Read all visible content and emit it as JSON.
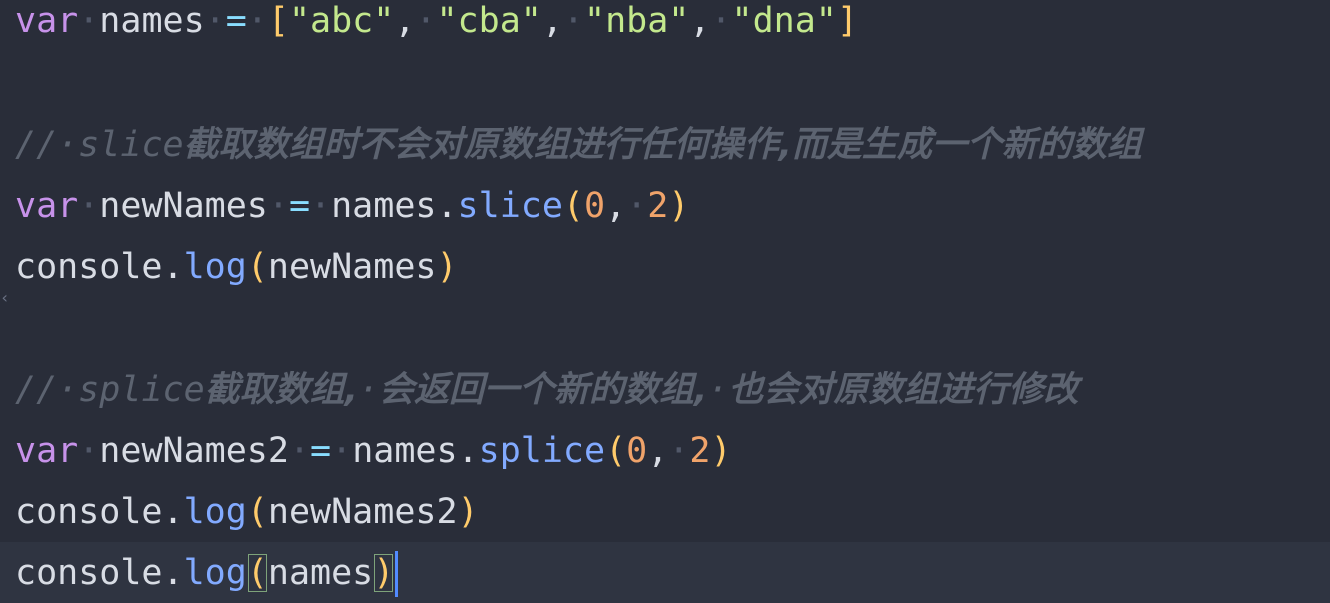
{
  "editor": {
    "background": "#292d39",
    "colors": {
      "keyword": "#c792ea",
      "identifier": "#d8dce4",
      "operator": "#89ddff",
      "string": "#c3e88d",
      "number": "#f0a36a",
      "function": "#82aaff",
      "bracket": "#ffcb6b",
      "comment": "#5c6370",
      "cursor": "#528bff"
    },
    "line1": {
      "kw": "var",
      "name": "names",
      "eq": "=",
      "open": "[",
      "s1": "\"abc\"",
      "s2": "\"cba\"",
      "s3": "\"nba\"",
      "s4": "\"dna\"",
      "close": "]"
    },
    "line3": {
      "slashes": "//",
      "word": "slice",
      "text": "截取数组时不会对原数组进行任何操作,而是生成一个新的数组"
    },
    "line4": {
      "kw": "var",
      "name": "newNames",
      "eq": "=",
      "obj": "names",
      "dot": ".",
      "method": "slice",
      "open": "(",
      "a": "0",
      "comma": ",",
      "b": "2",
      "close": ")"
    },
    "line5": {
      "obj": "console",
      "dot": ".",
      "method": "log",
      "open": "(",
      "arg": "newNames",
      "close": ")"
    },
    "line7": {
      "slashes": "//",
      "word": "splice",
      "text1": "截取数组,",
      "text2": "会返回一个新的数组,",
      "text3": "也会对原数组进行修改"
    },
    "line8": {
      "kw": "var",
      "name": "newNames2",
      "eq": "=",
      "obj": "names",
      "dot": ".",
      "method": "splice",
      "open": "(",
      "a": "0",
      "comma": ",",
      "b": "2",
      "close": ")"
    },
    "line9": {
      "obj": "console",
      "dot": ".",
      "method": "log",
      "open": "(",
      "arg": "newNames2",
      "close": ")"
    },
    "line10": {
      "obj": "console",
      "dot": ".",
      "method": "log",
      "open": "(",
      "arg": "names",
      "close": ")"
    }
  }
}
